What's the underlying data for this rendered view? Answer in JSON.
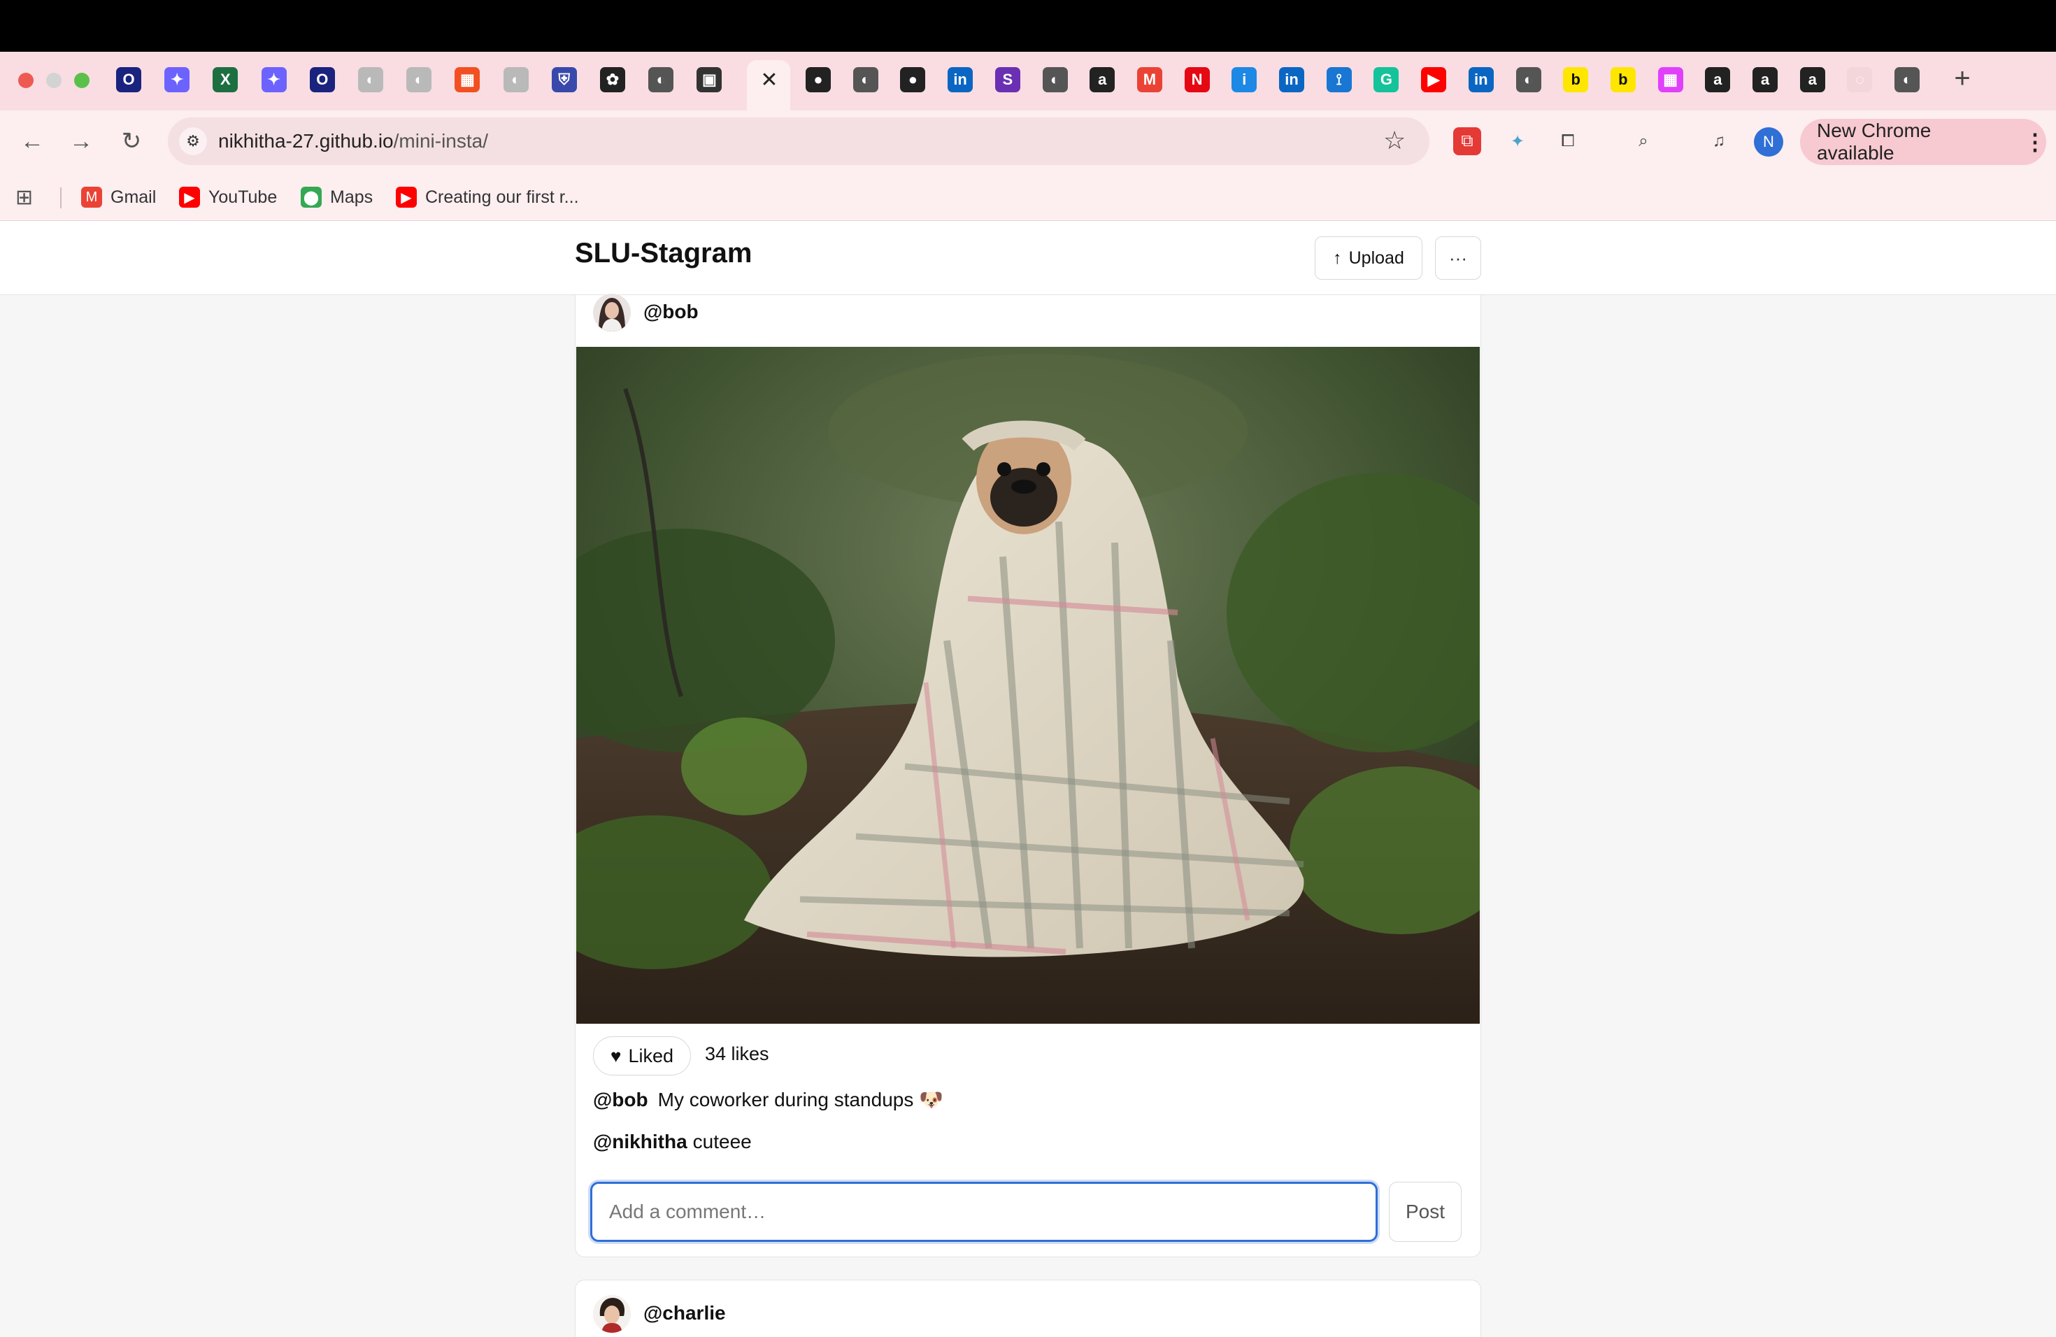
{
  "browser": {
    "url_host": "nikhitha-27.github.io",
    "url_path": "/mini-insta/",
    "update_label": "New Chrome available",
    "profile_initial": "N",
    "tabs": [
      {
        "icon": "opera-icon",
        "glyph": "O",
        "bg": "#1a237e"
      },
      {
        "icon": "copilot-icon",
        "glyph": "✦",
        "bg": "#6c63ff"
      },
      {
        "icon": "excel-icon",
        "glyph": "X",
        "bg": "#1d6f42"
      },
      {
        "icon": "copilot-icon",
        "glyph": "✦",
        "bg": "#6c63ff"
      },
      {
        "icon": "opera-icon",
        "glyph": "O",
        "bg": "#1a237e"
      },
      {
        "icon": "globe-icon",
        "glyph": "◐",
        "bg": "#b9b9b9"
      },
      {
        "icon": "globe-icon",
        "glyph": "◐",
        "bg": "#b9b9b9"
      },
      {
        "icon": "microsoft-icon",
        "glyph": "▦",
        "bg": "#f25022"
      },
      {
        "icon": "globe-icon",
        "glyph": "◐",
        "bg": "#b9b9b9"
      },
      {
        "icon": "shield-icon",
        "glyph": "⛨",
        "bg": "#3949ab"
      },
      {
        "icon": "openai-icon",
        "glyph": "✿",
        "bg": "#222222"
      },
      {
        "icon": "globe-icon",
        "glyph": "◐",
        "bg": "#555555"
      },
      {
        "icon": "gallery-icon",
        "glyph": "▣",
        "bg": "#333333"
      }
    ],
    "tabs_after": [
      {
        "icon": "github-icon",
        "glyph": "●",
        "bg": "#222222"
      },
      {
        "icon": "globe-icon",
        "glyph": "◐",
        "bg": "#555555"
      },
      {
        "icon": "github-icon",
        "glyph": "●",
        "bg": "#222222"
      },
      {
        "icon": "linkedin-icon",
        "glyph": "in",
        "bg": "#0a66c2"
      },
      {
        "icon": "s-icon",
        "glyph": "S",
        "bg": "#6b2fb3"
      },
      {
        "icon": "globe-icon",
        "glyph": "◐",
        "bg": "#555555"
      },
      {
        "icon": "amazon-icon",
        "glyph": "a",
        "bg": "#222222"
      },
      {
        "icon": "gmail-icon",
        "glyph": "M",
        "bg": "#ea4335"
      },
      {
        "icon": "netflix-icon",
        "glyph": "N",
        "bg": "#e50914"
      },
      {
        "icon": "info-icon",
        "glyph": "i",
        "bg": "#1e88e5"
      },
      {
        "icon": "linkedin-icon",
        "glyph": "in",
        "bg": "#0a66c2"
      },
      {
        "icon": "tie-icon",
        "glyph": "⟟",
        "bg": "#1976d2"
      },
      {
        "icon": "grammarly-icon",
        "glyph": "G",
        "bg": "#15c39a"
      },
      {
        "icon": "youtube-icon",
        "glyph": "▶",
        "bg": "#ff0000"
      },
      {
        "icon": "linkedin-icon",
        "glyph": "in",
        "bg": "#0a66c2"
      },
      {
        "icon": "globe-icon",
        "glyph": "◐",
        "bg": "#555555"
      },
      {
        "icon": "b-icon",
        "glyph": "b",
        "bg": "#ffe600"
      },
      {
        "icon": "b-icon",
        "glyph": "b",
        "bg": "#ffe600"
      },
      {
        "icon": "colorful-icon",
        "glyph": "▦",
        "bg": "#e040fb"
      },
      {
        "icon": "amazon-icon",
        "glyph": "a",
        "bg": "#222222"
      },
      {
        "icon": "amazon-icon",
        "glyph": "a",
        "bg": "#222222"
      },
      {
        "icon": "amazon-icon",
        "glyph": "a",
        "bg": "#222222"
      },
      {
        "icon": "loading-icon",
        "glyph": "◌",
        "bg": "#f3d6da"
      },
      {
        "icon": "globe-icon",
        "glyph": "◐",
        "bg": "#555555"
      }
    ],
    "bookmarks": [
      {
        "label": "Gmail",
        "icon": "gmail-icon",
        "glyph": "M",
        "bg": "#ea4335"
      },
      {
        "label": "YouTube",
        "icon": "youtube-icon",
        "glyph": "▶",
        "bg": "#ff0000"
      },
      {
        "label": "Maps",
        "icon": "maps-pin-icon",
        "glyph": "⬤",
        "bg": "#34a853"
      },
      {
        "label": "Creating our first r...",
        "icon": "youtube-icon",
        "glyph": "▶",
        "bg": "#ff0000"
      }
    ]
  },
  "app": {
    "title": "SLU-Stagram",
    "upload_label": "Upload",
    "more_label": "···"
  },
  "post": {
    "username": "@bob",
    "like_label": "Liked",
    "likes_text": "34 likes",
    "caption_user": "@bob",
    "caption_text": "My coworker during standups 🐶",
    "comment_user": "@nikhitha",
    "comment_text": "cuteee",
    "comment_placeholder": "Add a comment…",
    "post_label": "Post"
  },
  "next_post": {
    "username": "@charlie"
  }
}
